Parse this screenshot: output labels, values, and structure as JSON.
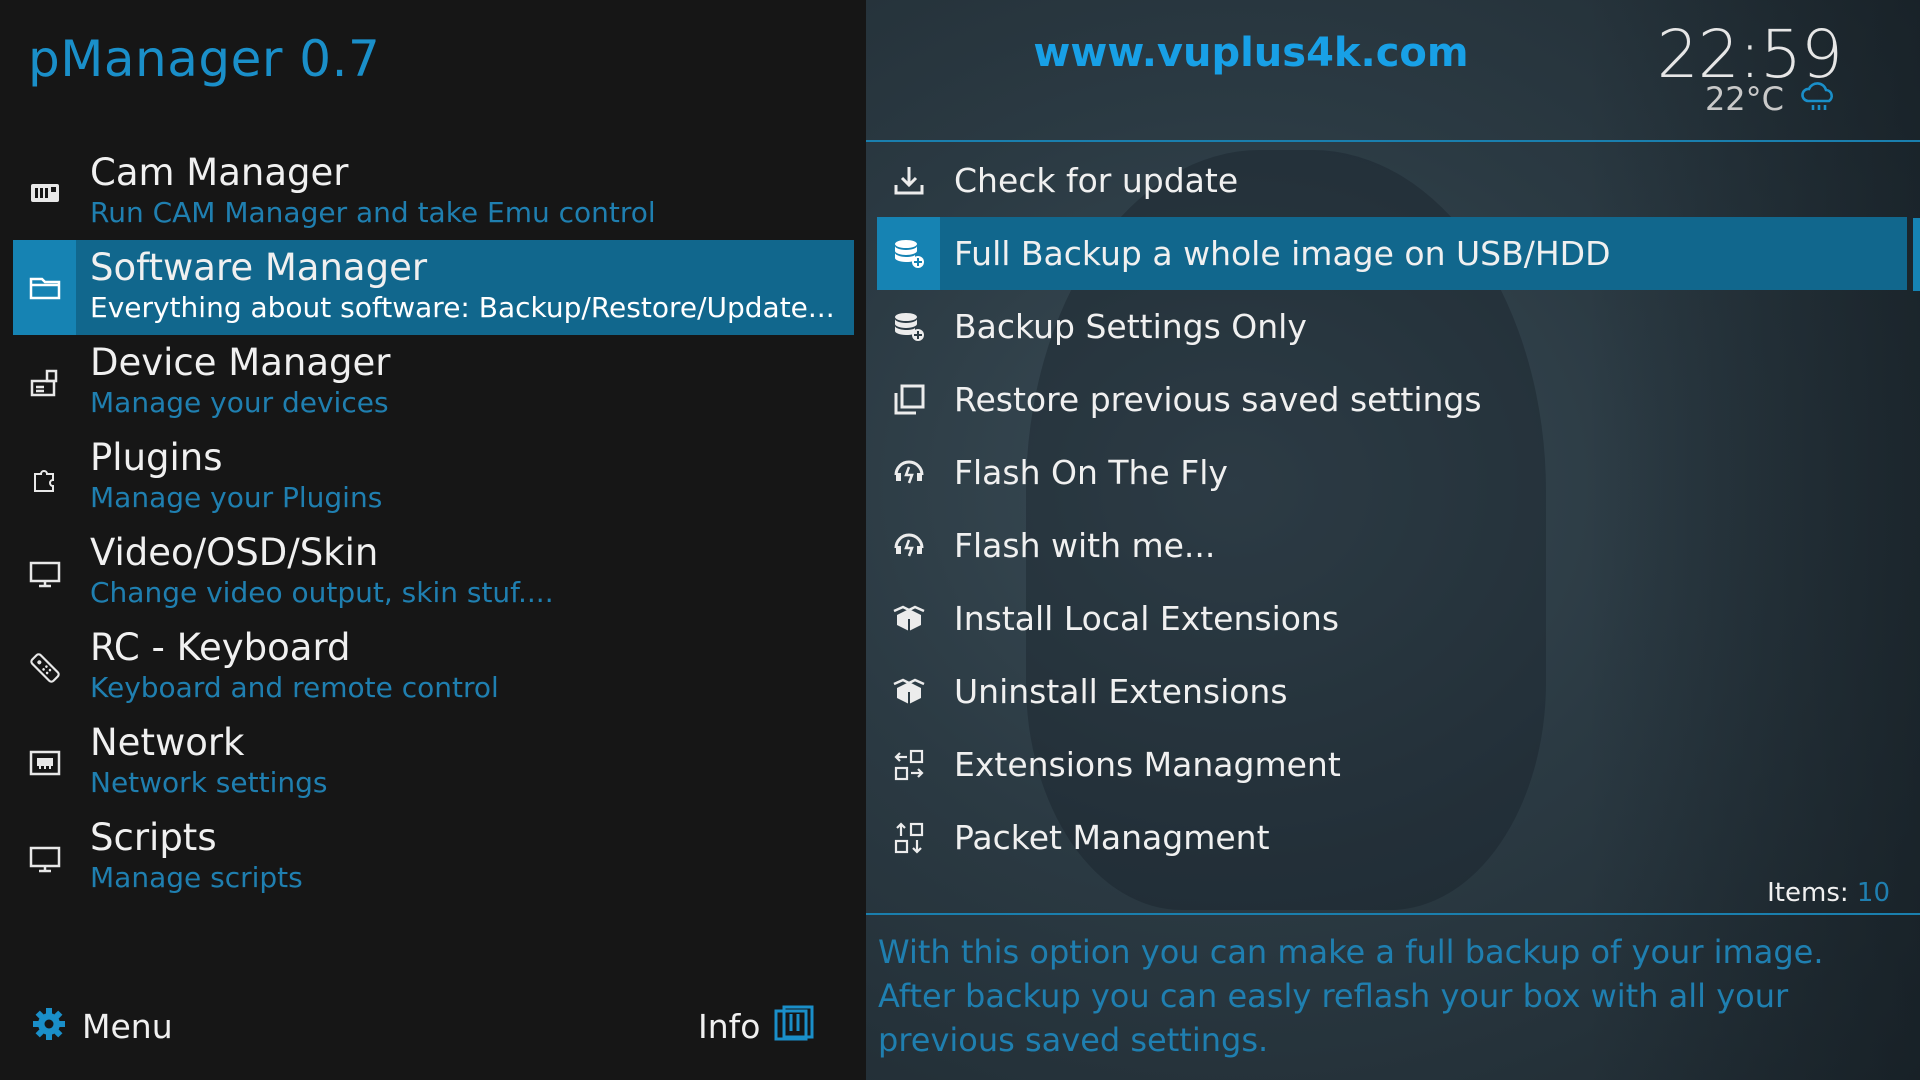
{
  "app": {
    "title": "pManager 0.7"
  },
  "main_menu": [
    {
      "label": "Cam Manager",
      "desc": "Run CAM Manager and take Emu control",
      "icon": "cam-icon",
      "selected": false
    },
    {
      "label": "Software Manager",
      "desc": "Everything about software: Backup/Restore/Update...",
      "icon": "folder-icon",
      "selected": true
    },
    {
      "label": "Device Manager",
      "desc": "Manage your devices",
      "icon": "device-icon",
      "selected": false
    },
    {
      "label": "Plugins",
      "desc": "Manage your Plugins",
      "icon": "puzzle-icon",
      "selected": false
    },
    {
      "label": "Video/OSD/Skin",
      "desc": "Change video output, skin stuf....",
      "icon": "monitor-icon",
      "selected": false
    },
    {
      "label": "RC - Keyboard",
      "desc": "Keyboard and remote control",
      "icon": "remote-icon",
      "selected": false
    },
    {
      "label": "Network",
      "desc": "Network settings",
      "icon": "network-icon",
      "selected": false
    },
    {
      "label": "Scripts",
      "desc": "Manage scripts",
      "icon": "scripts-icon",
      "selected": false
    }
  ],
  "footer": {
    "menu_label": "Menu",
    "info_label": "Info"
  },
  "header": {
    "site_url": "www.vuplus4k.com",
    "clock": "22:59",
    "temperature": "22°C",
    "weather_icon": "cloud-rain-icon"
  },
  "sub_menu": [
    {
      "label": "Check for update",
      "icon": "download-icon",
      "selected": false
    },
    {
      "label": "Full Backup a whole image on USB/HDD",
      "icon": "database-add-icon",
      "selected": true
    },
    {
      "label": "Backup Settings Only",
      "icon": "database-add-icon",
      "selected": false
    },
    {
      "label": "Restore previous saved settings",
      "icon": "restore-icon",
      "selected": false
    },
    {
      "label": "Flash On The Fly",
      "icon": "flash-icon",
      "selected": false
    },
    {
      "label": "Flash with me...",
      "icon": "flash-icon",
      "selected": false
    },
    {
      "label": "Install Local Extensions",
      "icon": "box-icon",
      "selected": false
    },
    {
      "label": "Uninstall Extensions",
      "icon": "box-icon",
      "selected": false
    },
    {
      "label": "Extensions Managment",
      "icon": "swap-horizontal-icon",
      "selected": false
    },
    {
      "label": "Packet Managment",
      "icon": "swap-vertical-icon",
      "selected": false
    }
  ],
  "items": {
    "label": "Items:",
    "count": "10"
  },
  "description": "With this option you can make a full backup of your image. After backup you can easly reflash your box with all your previous saved settings.",
  "colors": {
    "accent": "#1a8fc9",
    "selected_bg": "#11678d",
    "selected_icon_bg": "#1683b3",
    "desc_text": "#1f7fb0"
  }
}
